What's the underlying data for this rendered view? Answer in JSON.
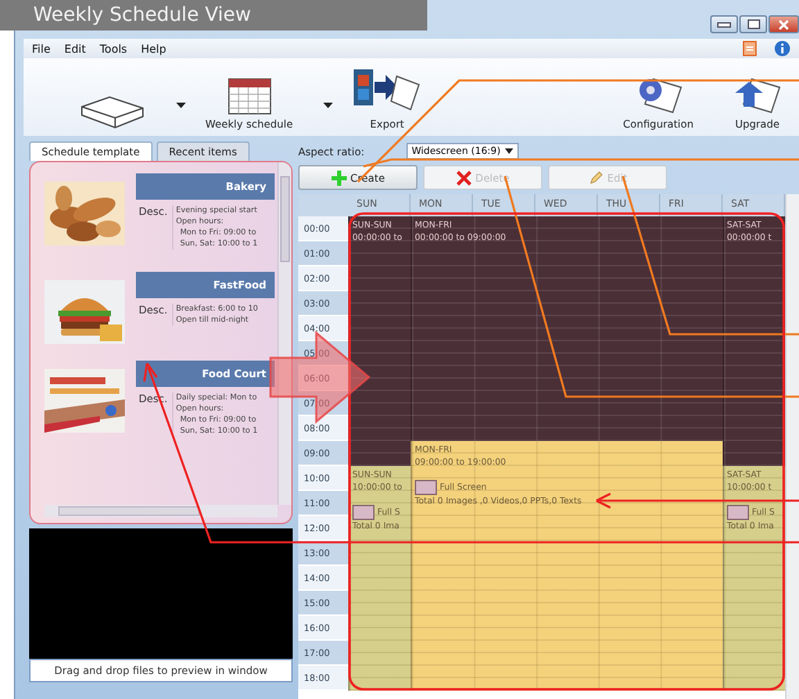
{
  "banner": {
    "title": "Weekly Schedule View"
  },
  "menu": [
    "File",
    "Edit",
    "Tools",
    "Help"
  ],
  "toolbar": {
    "left": [
      {
        "kind": "device",
        "dropdown": true
      },
      {
        "kind": "calendar",
        "label": "Weekly schedule",
        "dropdown": true
      },
      {
        "kind": "export",
        "label": "Export"
      }
    ],
    "right": [
      {
        "kind": "gear",
        "label": "Configuration"
      },
      {
        "kind": "upgrade",
        "label": "Upgrade"
      }
    ]
  },
  "tabs": [
    {
      "label": "Schedule template",
      "selected": true
    },
    {
      "label": "Recent items",
      "selected": false
    }
  ],
  "aspect": {
    "label": "Aspect ratio:",
    "value": "Widescreen (16:9)"
  },
  "templates": [
    {
      "title": "Bakery",
      "desc_label": "Desc.",
      "lines": [
        "Evening special start",
        "Open hours:",
        "Mon to Fri: 09:00 to",
        "Sun, Sat: 10:00 to 1"
      ]
    },
    {
      "title": "FastFood",
      "desc_label": "Desc.",
      "lines": [
        "Breakfast: 6:00 to 10",
        "Open till mid-night"
      ]
    },
    {
      "title": "Food Court",
      "desc_label": "Desc.",
      "lines": [
        "Daily special: Mon to",
        "Open hours:",
        "Mon to Fri: 09:00 to",
        "Sun, Sat: 10:00 to 1"
      ]
    }
  ],
  "preview": {
    "caption": "Drag and drop files to preview in window"
  },
  "actions": [
    {
      "kind": "create",
      "label": "Create",
      "disabled": false
    },
    {
      "kind": "delete",
      "label": "Delete",
      "disabled": true
    },
    {
      "kind": "edit",
      "label": "Edit",
      "disabled": true
    }
  ],
  "schedule": {
    "days": [
      "SUN",
      "MON",
      "TUE",
      "WED",
      "THU",
      "FRI",
      "SAT"
    ],
    "hours": [
      {
        "label": "00:00",
        "events": [
          {
            "label": "SUN-SUN",
            "time": "00:00:00 to",
            "color": "#4b2f37"
          },
          {
            "label": "MON-FRI",
            "time": "00:00:00 to 09:00:00",
            "color": "#4b2f37"
          },
          {
            "label": "SAT-SAT",
            "time": "00:00:00 t",
            "color": "#4b2f37"
          }
        ]
      },
      {
        "label": "01:00"
      },
      {
        "label": "02:00"
      },
      {
        "label": "03:00"
      },
      {
        "label": "04:00"
      },
      {
        "label": "05:00"
      },
      {
        "label": "06:00"
      },
      {
        "label": "07:00"
      },
      {
        "label": "08:00"
      },
      {
        "label": "09:00",
        "events": [
          {
            "label": "MON-FRI",
            "time": "09:00:00 to 19:00:00",
            "screen": "Full Screen",
            "totals": "Total 0 Images ,0 Videos,0 PPTs,0 Texts",
            "color": "#f4d27c"
          }
        ]
      },
      {
        "label": "10:00",
        "events": [
          {
            "label": "SUN-SUN",
            "time": "10:00:00 to",
            "screen": "Full S",
            "totals": "Total 0 Ima",
            "color": "#d6cf8c"
          },
          {
            "label": "SAT-SAT",
            "time": "10:00:00 t",
            "screen": "Full S",
            "totals": "Total 0 Ima",
            "color": "#d6cf8c"
          }
        ]
      },
      {
        "label": "11:00"
      },
      {
        "label": "12:00"
      },
      {
        "label": "13:00"
      },
      {
        "label": "14:00"
      },
      {
        "label": "15:00"
      },
      {
        "label": "16:00"
      },
      {
        "label": "17:00"
      },
      {
        "label": "18:00"
      }
    ]
  }
}
